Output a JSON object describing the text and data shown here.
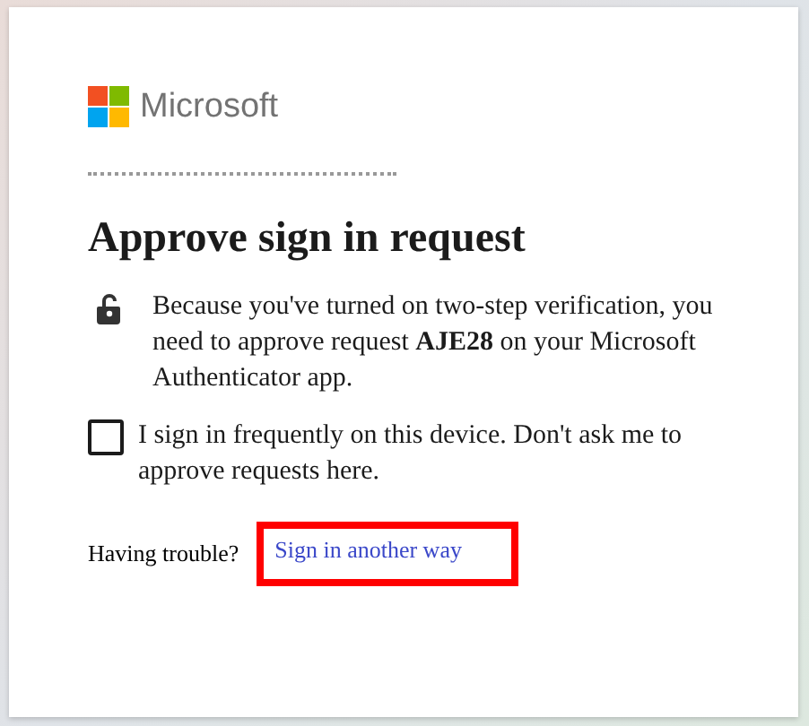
{
  "brand": {
    "name": "Microsoft"
  },
  "title": "Approve sign in request",
  "message": "Because you've turned on two-step verification, you need to approve request **AJE28** on your Microsoft Authenticator app.",
  "remember": {
    "label": "I sign in frequently on this device. Don't ask me to approve requests here.",
    "checked": false
  },
  "trouble": {
    "text": "Having trouble?",
    "link": "Sign in another way",
    "highlighted": true
  }
}
